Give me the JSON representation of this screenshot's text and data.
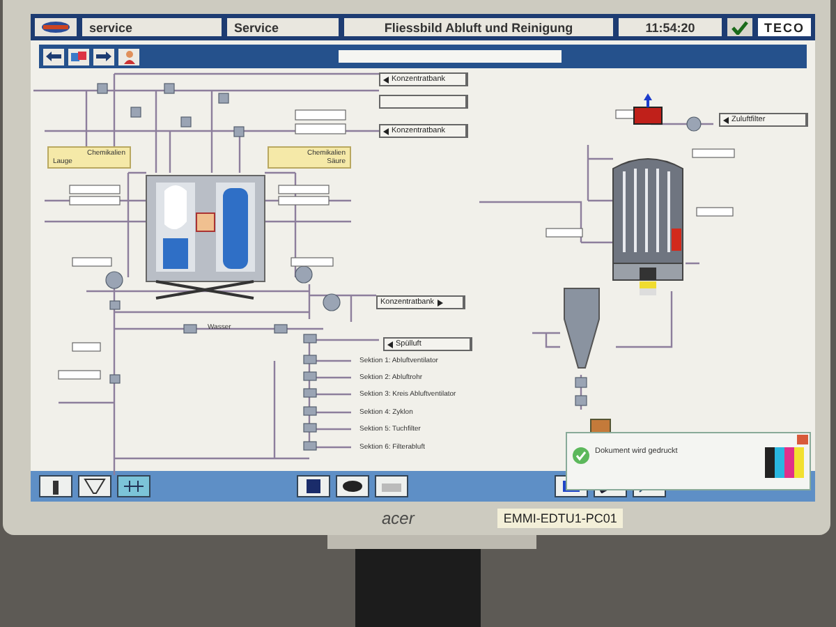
{
  "header": {
    "user": "service",
    "role": "Service",
    "title": "Fliessbild Abluft und Reinigung",
    "time": "11:54:20",
    "confirmed": true,
    "logo": "TECO"
  },
  "diagram": {
    "tags": [
      {
        "label": "Konzentratbank",
        "kind": "in"
      },
      {
        "label": "Konzentratbank",
        "kind": "in"
      },
      {
        "label": "Konzentratbank",
        "kind": "out"
      },
      {
        "label": "Spülluft",
        "kind": "in"
      },
      {
        "label": "Zuluftfilter",
        "kind": "in"
      }
    ],
    "chemicals": [
      {
        "title": "Chemikalien",
        "feed": "Lauge"
      },
      {
        "title": "Chemikalien",
        "feed": "Säure"
      }
    ],
    "water": "Wasser",
    "sections": [
      "Sektion 1: Abluftventilator",
      "Sektion 2: Abluftrohr",
      "Sektion 3: Kreis Abluftventilator",
      "Sektion 4: Zyklon",
      "Sektion 5: Tuchfilter",
      "Sektion 6: Filterabluft"
    ]
  },
  "notification": {
    "title": "Dokument wird gedruckt"
  },
  "monitor": {
    "brand": "acer",
    "sticker": "EMMI-EDTU1-PC01"
  }
}
